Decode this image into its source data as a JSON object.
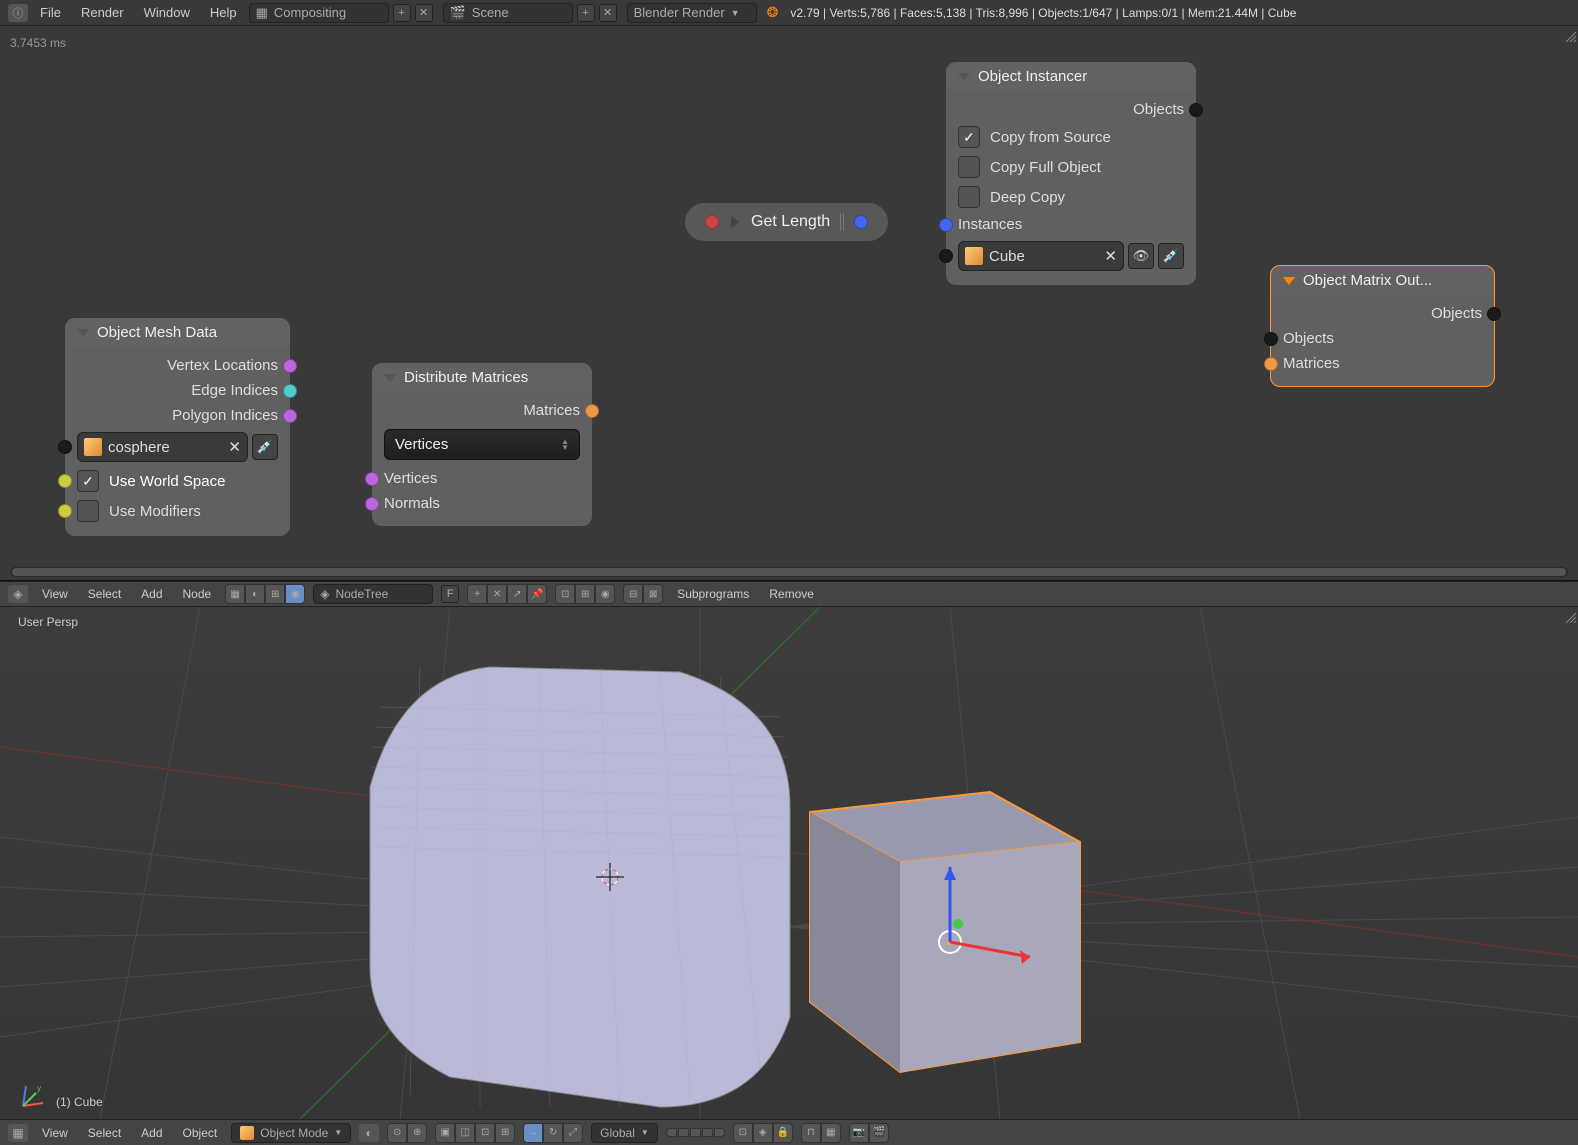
{
  "topbar": {
    "menus": [
      "File",
      "Render",
      "Window",
      "Help"
    ],
    "layout_dd": "Compositing",
    "scene_dd": "Scene",
    "engine_dd": "Blender Render",
    "stats": "v2.79 | Verts:5,786 | Faces:5,138 | Tris:8,996 | Objects:1/647 | Lamps:0/1 | Mem:21.44M | Cube"
  },
  "nodeeditor": {
    "timing": "3.7453 ms",
    "nodes": {
      "mesh_data": {
        "title": "Object Mesh Data",
        "out1": "Vertex Locations",
        "out2": "Edge Indices",
        "out3": "Polygon Indices",
        "obj": "cosphere",
        "opt1": "Use World Space",
        "opt2": "Use Modifiers"
      },
      "dist_matrices": {
        "title": "Distribute Matrices",
        "out1": "Matrices",
        "mode": "Vertices",
        "in1": "Vertices",
        "in2": "Normals"
      },
      "get_length": {
        "title": "Get Length"
      },
      "obj_instancer": {
        "title": "Object Instancer",
        "out1": "Objects",
        "opt1": "Copy from Source",
        "opt2": "Copy Full Object",
        "opt3": "Deep Copy",
        "in1": "Instances",
        "obj": "Cube"
      },
      "matrix_out": {
        "title": "Object Matrix Out...",
        "out1": "Objects",
        "in1": "Objects",
        "in2": "Matrices"
      }
    }
  },
  "nodebar": {
    "menus": [
      "View",
      "Select",
      "Add",
      "Node"
    ],
    "tree": "NodeTree",
    "sub": "Subprograms",
    "remove": "Remove",
    "f_label": "F"
  },
  "viewport": {
    "persp": "User Persp",
    "sel_label": "(1) Cube"
  },
  "viewbar": {
    "menus": [
      "View",
      "Select",
      "Add",
      "Object"
    ],
    "mode": "Object Mode",
    "orient": "Global"
  }
}
